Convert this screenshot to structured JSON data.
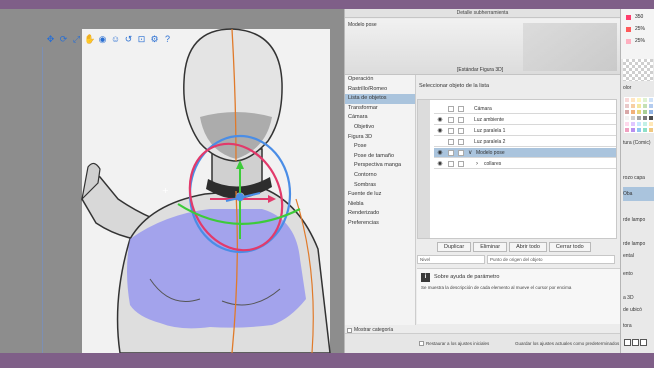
{
  "canvas": {
    "toolbar_icons": [
      "move-icon",
      "rotate-icon",
      "scale-icon",
      "pan-icon",
      "camera-icon",
      "pose-icon",
      "reset-icon",
      "lock-icon",
      "settings-icon",
      "help-icon"
    ],
    "gizmo_colors": {
      "x": "#e23a6b",
      "y": "#3dcb3a",
      "z": "#4a8de6",
      "mask": "#8f8ff0"
    }
  },
  "panel": {
    "title": "Detalle subherramienta",
    "preview_label": "Modelo pose",
    "preview_caption": "[Estándar Figura 3D]",
    "nav": [
      {
        "label": "Operación",
        "sub": false
      },
      {
        "label": "Rastrillo/Romeo",
        "sub": false
      },
      {
        "label": "Lista de objetos",
        "sub": false,
        "selected": true
      },
      {
        "label": "Transformar",
        "sub": false
      },
      {
        "label": "Cámara",
        "sub": false
      },
      {
        "label": "Objetivo",
        "sub": true
      },
      {
        "label": "Figura 3D",
        "sub": false
      },
      {
        "label": "Pose",
        "sub": true
      },
      {
        "label": "Pose de tamaño",
        "sub": true
      },
      {
        "label": "Perspectiva manga",
        "sub": true
      },
      {
        "label": "Contorno",
        "sub": true
      },
      {
        "label": "Sombras",
        "sub": true
      },
      {
        "label": "Fuente de luz",
        "sub": false
      },
      {
        "label": "Niebla",
        "sub": false
      },
      {
        "label": "Renderizado",
        "sub": false
      },
      {
        "label": "Preferencias",
        "sub": false
      }
    ],
    "show_category": "Mostrar categoría",
    "list_header": "Seleccionar objeto de la lista",
    "list_rows": [
      {
        "label": "Cámara",
        "eye": false,
        "indent": 0,
        "arrow": "",
        "selected": false
      },
      {
        "label": "Luz ambiente",
        "eye": true,
        "indent": 0,
        "arrow": "",
        "selected": false
      },
      {
        "label": "Luz paralela 1",
        "eye": true,
        "indent": 0,
        "arrow": "",
        "selected": false
      },
      {
        "label": "Luz paralela 2",
        "eye": false,
        "indent": 0,
        "arrow": "",
        "selected": false
      },
      {
        "label": "Modelo pose",
        "eye": true,
        "indent": 0,
        "arrow": "∨",
        "selected": true
      },
      {
        "label": "collares",
        "eye": true,
        "indent": 1,
        "arrow": "›",
        "selected": false
      }
    ],
    "buttons": {
      "duplicate": "Duplicar",
      "delete": "Eliminar",
      "open_all": "Abrir todo",
      "close_all": "Cerrar todo"
    },
    "select_small": "Nivel",
    "select_large": "Punto de origen del objeto",
    "help_title": "Sobre ayuda de parámetro",
    "help_text": "Se muestra la descripción de cada elemento al mueve el cursor por encima",
    "footer_check": "Restaurar a los ajustes iniciales",
    "footer_text": "Guardar los ajustes actuales como predeterminados"
  },
  "right_panel": {
    "values": [
      "350",
      "25%",
      "25%"
    ],
    "labels": [
      "olor",
      "tura (Comic)",
      "rozo capa",
      "Oba",
      "rde lampo",
      "rde lampo",
      "ental",
      "ento",
      "de ubicó",
      "a 3D",
      "tora"
    ],
    "swatch_colors": [
      "#ff3d6e",
      "#ff5a5a",
      "#ffb0c0",
      "#d9d9d9",
      "#7b7b7b"
    ],
    "palette": [
      "#f9d8d8",
      "#ffe5c2",
      "#fff6c0",
      "#dff2d0",
      "#cfe2f9",
      "#e9c9c9",
      "#f7cfa3",
      "#f4e8a0",
      "#c5e1b5",
      "#b4ccef",
      "#d8a8a8",
      "#f1b07a",
      "#e9d77a",
      "#a9cf95",
      "#90b3e4",
      "#f2f2f2",
      "#d0d0d0",
      "#a5a5a5",
      "#7a7a7a",
      "#4b4b4b",
      "#ffd9ec",
      "#e0c7ff",
      "#c7e8ff",
      "#c2f0e6",
      "#ffe8b8",
      "#f0a0c0",
      "#b890f0",
      "#90c8f0",
      "#8ee0c8",
      "#f0c880"
    ]
  }
}
